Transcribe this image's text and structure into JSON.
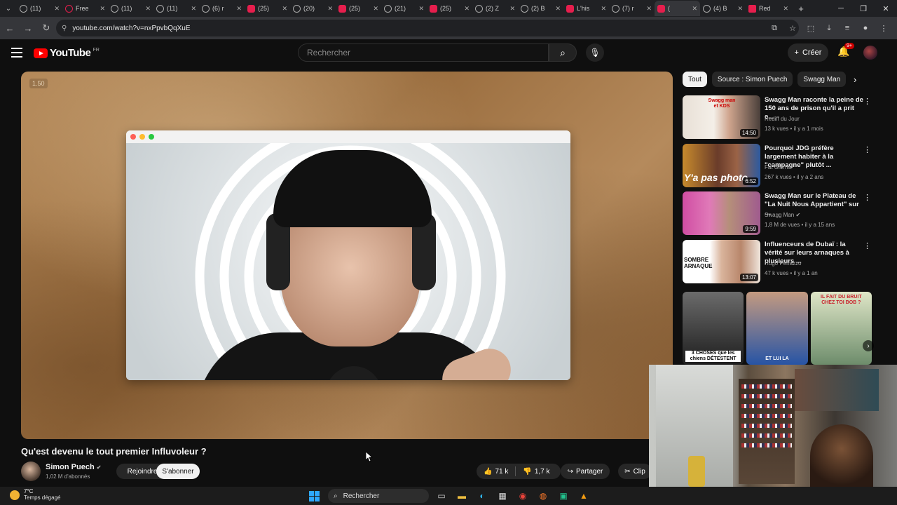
{
  "browser": {
    "tabs": [
      {
        "label": "(11)",
        "icon": "x-icon"
      },
      {
        "label": "Free",
        "icon": "ring-icon"
      },
      {
        "label": "(11)",
        "icon": "x-icon"
      },
      {
        "label": "(11)",
        "icon": "x-icon"
      },
      {
        "label": "(6) r",
        "icon": "x-icon"
      },
      {
        "label": "(25)",
        "icon": "youtube-icon"
      },
      {
        "label": "(20)",
        "icon": "x-icon"
      },
      {
        "label": "(25)",
        "icon": "youtube-icon"
      },
      {
        "label": "(21)",
        "icon": "x-icon"
      },
      {
        "label": "(25)",
        "icon": "youtube-icon"
      },
      {
        "label": "(2) Z",
        "icon": "x-icon"
      },
      {
        "label": "(2) B",
        "icon": "x-icon"
      },
      {
        "label": "L'his",
        "icon": "youtube-icon"
      },
      {
        "label": "(7) r",
        "icon": "x-icon"
      },
      {
        "label": "(",
        "icon": "youtube-icon",
        "active": true
      },
      {
        "label": "(4) B",
        "icon": "x-icon"
      },
      {
        "label": "Red",
        "icon": "square-icon"
      }
    ],
    "url": "youtube.com/watch?v=nxPpvbQqXuE"
  },
  "youtube": {
    "logo_text": "YouTube",
    "country_code": "FR",
    "search_placeholder": "Rechercher",
    "create_label": "Créer",
    "notif_count": "9+"
  },
  "video": {
    "speed_label": "1.50",
    "title": "Qu'est devenu le tout premier Influvoleur ?",
    "channel_name": "Simon Puech",
    "subscribers": "1,02 M d'abonnés",
    "join_label": "Rejoindre",
    "subscribe_label": "S'abonner",
    "likes": "71 k",
    "dislikes": "1,7 k",
    "share_label": "Partager",
    "clip_label": "Clip"
  },
  "chips": [
    "Tout",
    "Source : Simon Puech",
    "Swagg Man"
  ],
  "recommendations": [
    {
      "title": "Swagg Man raconte la peine de 150 ans de prison qu'il a prit e...",
      "channel": "Rediff du Jour",
      "meta": "13 k vues • il y a 1 mois",
      "duration": "14:50"
    },
    {
      "title": "Pourquoi JDG préfère largement habiter à la \"campagne\" plutôt ...",
      "channel": "Fat Giorno",
      "meta": "267 k vues • il y a 2 ans",
      "duration": "6:52"
    },
    {
      "title": "Swagg Man sur le Plateau de \"La Nuit Nous Appartient\" sur ...",
      "channel": "Swagg Man",
      "meta": "1,8 M de vues • il y a 15 ans",
      "duration": "9:59"
    },
    {
      "title": "Influenceurs de Dubaï : la vérité sur leurs arnaques à plusieurs ...",
      "channel": "Hugo Penazzo",
      "meta": "47 k vues • il y a 1 an",
      "duration": "13:07"
    }
  ],
  "shorts": [
    {
      "caption": "3 CHOSES que les chiens DÉTESTENT"
    },
    {
      "caption": "ET LUI LA"
    },
    {
      "caption": "IL FAIT DU BRUIT CHEZ TOI BOB ?"
    }
  ],
  "thumb_texts": {
    "t1": "Swagg man et KDS",
    "t2": "Y'a pas photo",
    "t4": "SOMBRE ARNAQUE"
  },
  "taskbar": {
    "weather_temp": "7°C",
    "weather_desc": "Temps dégagé",
    "search_label": "Rechercher"
  }
}
